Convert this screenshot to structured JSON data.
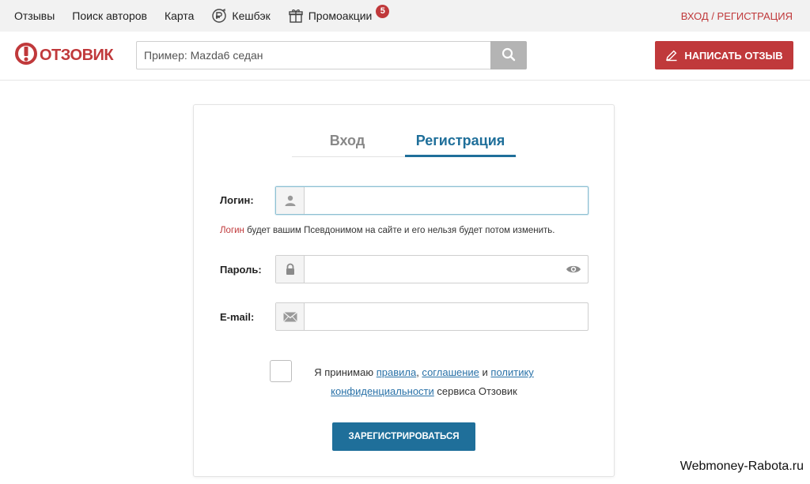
{
  "topnav": {
    "items": [
      {
        "label": "Отзывы"
      },
      {
        "label": "Поиск авторов"
      },
      {
        "label": "Карта"
      },
      {
        "label": "Кешбэк",
        "icon": "cashback-icon"
      },
      {
        "label": "Промоакции",
        "icon": "gift-icon",
        "badge": "5"
      }
    ],
    "auth_label": "Вход / Регистрация"
  },
  "header": {
    "logo_text": "ОТЗОВИК",
    "search_placeholder": "Пример: Mazda6 седан",
    "search_icon": "search-icon",
    "write_review_label": "Написать отзыв"
  },
  "colors": {
    "brand_red": "#c0393b",
    "accent_blue": "#1f6f9a",
    "link_blue": "#2a72a8"
  },
  "form": {
    "tabs": [
      {
        "label": "Вход",
        "active": false
      },
      {
        "label": "Регистрация",
        "active": true
      }
    ],
    "login_label": "Логин:",
    "login_value": "",
    "hint_highlight": "Логин",
    "hint_rest": " будет вашим Псевдонимом на сайте и его нельзя будет потом изменить.",
    "password_label": "Пароль:",
    "password_value": "",
    "email_label": "E-mail:",
    "email_value": "",
    "agree_prefix": "Я принимаю ",
    "agree_link_rules": "правила",
    "agree_sep1": ", ",
    "agree_link_agreement": "соглашение",
    "agree_sep2": " и ",
    "agree_link_policy": "политику конфиденциальности",
    "agree_suffix": " сервиса Отзовик",
    "agree_checked": false,
    "submit_label": "Зарегистрироваться"
  },
  "watermark": "Webmoney-Rabota.ru"
}
